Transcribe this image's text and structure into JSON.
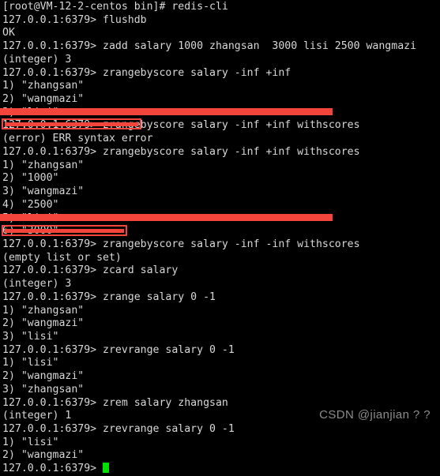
{
  "terminal": {
    "background_color": "#000000",
    "foreground_color": "#d8d8d8",
    "cursor_color": "#00e000",
    "redaction_color": "#f4453c",
    "lines": [
      {
        "id": "l0",
        "text": "[root@VM-12-2-centos bin]# redis-cli"
      },
      {
        "id": "l1",
        "text": "127.0.0.1:6379> flushdb"
      },
      {
        "id": "l2",
        "text": "OK"
      },
      {
        "id": "l3",
        "text": "127.0.0.1:6379> zadd salary 1000 zhangsan  3000 lisi 2500 wangmazi"
      },
      {
        "id": "l4",
        "text": "(integer) 3"
      },
      {
        "id": "l5",
        "text": "127.0.0.1:6379> zrangebyscore salary -inf +inf"
      },
      {
        "id": "l6",
        "text": "1) \"zhangsan\""
      },
      {
        "id": "l7",
        "text": "2) \"wangmazi\""
      },
      {
        "id": "l8",
        "text": "3) \"lisi\""
      },
      {
        "id": "l9",
        "text": "127.0.0.1:6379> zrangebyscore salary -inf +inf withscores"
      },
      {
        "id": "l10",
        "text": "(error) ERR syntax error"
      },
      {
        "id": "l11",
        "text": "127.0.0.1:6379> zrangebyscore salary -inf +inf withscores"
      },
      {
        "id": "l12",
        "text": "1) \"zhangsan\""
      },
      {
        "id": "l13",
        "text": "2) \"1000\""
      },
      {
        "id": "l14",
        "text": "3) \"wangmazi\""
      },
      {
        "id": "l15",
        "text": "4) \"2500\""
      },
      {
        "id": "l16",
        "text": "5) \"lisi\""
      },
      {
        "id": "l17",
        "text": "6) \"3000\""
      },
      {
        "id": "l18",
        "text": "127.0.0.1:6379> zrangebyscore salary -inf -inf withscores"
      },
      {
        "id": "l19",
        "text": "(empty list or set)"
      },
      {
        "id": "l20",
        "text": "127.0.0.1:6379> zcard salary"
      },
      {
        "id": "l21",
        "text": "(integer) 3"
      },
      {
        "id": "l22",
        "text": "127.0.0.1:6379> zrange salary 0 -1"
      },
      {
        "id": "l23",
        "text": "1) \"zhangsan\""
      },
      {
        "id": "l24",
        "text": "2) \"wangmazi\""
      },
      {
        "id": "l25",
        "text": "3) \"lisi\""
      },
      {
        "id": "l26",
        "text": "127.0.0.1:6379> zrevrange salary 0 -1"
      },
      {
        "id": "l27",
        "text": "1) \"lisi\""
      },
      {
        "id": "l28",
        "text": "2) \"wangmazi\""
      },
      {
        "id": "l29",
        "text": "3) \"zhangsan\""
      },
      {
        "id": "l30",
        "text": "127.0.0.1:6379> zrem salary zhangsan"
      },
      {
        "id": "l31",
        "text": "(integer) 1"
      },
      {
        "id": "l32",
        "text": "127.0.0.1:6379> zrevrange salary 0 -1"
      },
      {
        "id": "l33",
        "text": "1) \"lisi\""
      },
      {
        "id": "l34",
        "text": "2) \"wangmazi\""
      },
      {
        "id": "l35",
        "text": "127.0.0.1:6379> "
      }
    ],
    "prompt": "127.0.0.1:6379> "
  },
  "watermark": {
    "text": "CSDN @jianjian ? ?"
  }
}
